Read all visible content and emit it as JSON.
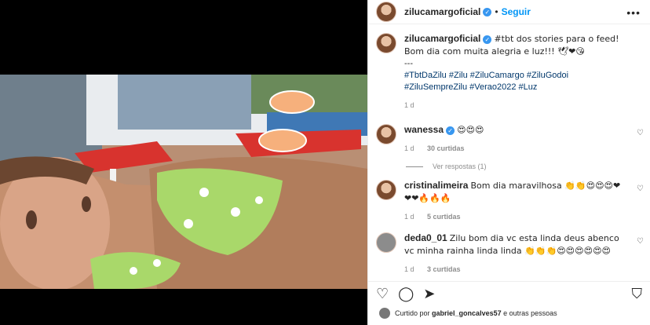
{
  "post": {
    "username": "zilucamargoficial",
    "follow_label": "Seguir",
    "dot": "•",
    "more_icon": "•••",
    "caption": "#tbt dos stories para o feed! Bom dia com muita alegria e luz!!! 🕊❤😘",
    "separator": "---",
    "hashtags": "#TbtDaZilu #Zilu #ZiluCamargo #ZiluGodoi #ZiluSempreZilu #Verao2022 #Luz",
    "time": "1 d"
  },
  "comments": [
    {
      "username": "wanessa",
      "verified": true,
      "text": "😍😍😍",
      "time": "1 d",
      "likes": "30 curtidas",
      "view_replies": "Ver respostas (1)"
    },
    {
      "username": "cristinalimeira",
      "verified": false,
      "text": "Bom dia maravilhosa 👏👏😍😍😍❤❤❤🔥🔥🔥",
      "time": "1 d",
      "likes": "5 curtidas"
    },
    {
      "username": "deda0_01",
      "verified": false,
      "text": "Zilu bom dia vc esta linda deus abenco vc minha rainha linda linda 👏👏👏😍😍😍😍😍😍",
      "time": "1 d",
      "likes": "3 curtidas"
    }
  ],
  "footer": {
    "liked_by_prefix": "Curtido por",
    "liked_by_user": "gabriel_goncalves57",
    "liked_by_suffix": "e outras pessoas"
  },
  "colors": {
    "accent": "#0095f6",
    "verified": "#3897f0",
    "link": "#00376b",
    "muted": "#8e8e8e"
  }
}
